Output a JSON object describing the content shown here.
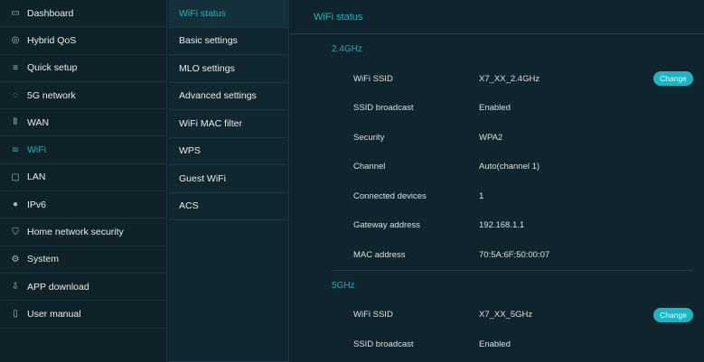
{
  "nav": {
    "items": [
      {
        "label": "Dashboard",
        "icon": "▭",
        "active": false
      },
      {
        "label": "Hybrid QoS",
        "icon": "◎",
        "active": false
      },
      {
        "label": "Quick setup",
        "icon": "≡",
        "active": false
      },
      {
        "label": "5G network",
        "icon": "◌",
        "active": false
      },
      {
        "label": "WAN",
        "icon": "⦀",
        "active": false
      },
      {
        "label": "WiFi",
        "icon": "≋",
        "active": true
      },
      {
        "label": "LAN",
        "icon": "▢",
        "active": false
      },
      {
        "label": "IPv6",
        "icon": "●",
        "active": false
      },
      {
        "label": "Home network security",
        "icon": "⛉",
        "active": false
      },
      {
        "label": "System",
        "icon": "⚙",
        "active": false
      },
      {
        "label": "APP download",
        "icon": "⇩",
        "active": false
      },
      {
        "label": "User manual",
        "icon": "▯",
        "active": false
      }
    ]
  },
  "submenu": {
    "items": [
      {
        "label": "WiFi status",
        "active": true
      },
      {
        "label": "Basic settings",
        "active": false
      },
      {
        "label": "MLO settings",
        "active": false
      },
      {
        "label": "Advanced settings",
        "active": false
      },
      {
        "label": "WiFi MAC filter",
        "active": false
      },
      {
        "label": "WPS",
        "active": false
      },
      {
        "label": "Guest WiFi",
        "active": false
      },
      {
        "label": "ACS",
        "active": false
      }
    ]
  },
  "main": {
    "title": "WiFi status",
    "band_24": {
      "heading": "2.4GHz",
      "rows": [
        {
          "label": "WiFi SSID",
          "value": "X7_XX_2.4GHz",
          "button": "Change"
        },
        {
          "label": "SSID broadcast",
          "value": "Enabled"
        },
        {
          "label": "Security",
          "value": "WPA2"
        },
        {
          "label": "Channel",
          "value": "Auto(channel 1)"
        },
        {
          "label": "Connected devices",
          "value": "1"
        },
        {
          "label": "Gateway address",
          "value": "192.168.1.1"
        },
        {
          "label": "MAC address",
          "value": "70:5A:6F:50:00:07"
        }
      ]
    },
    "band_5": {
      "heading": "5GHz",
      "rows": [
        {
          "label": "WiFi SSID",
          "value": "X7_XX_5GHz",
          "button": "Change"
        },
        {
          "label": "SSID broadcast",
          "value": "Enabled"
        }
      ]
    }
  },
  "colors": {
    "accent": "#16b6c3",
    "background": "#0e1f27",
    "panel": "#10242d"
  }
}
